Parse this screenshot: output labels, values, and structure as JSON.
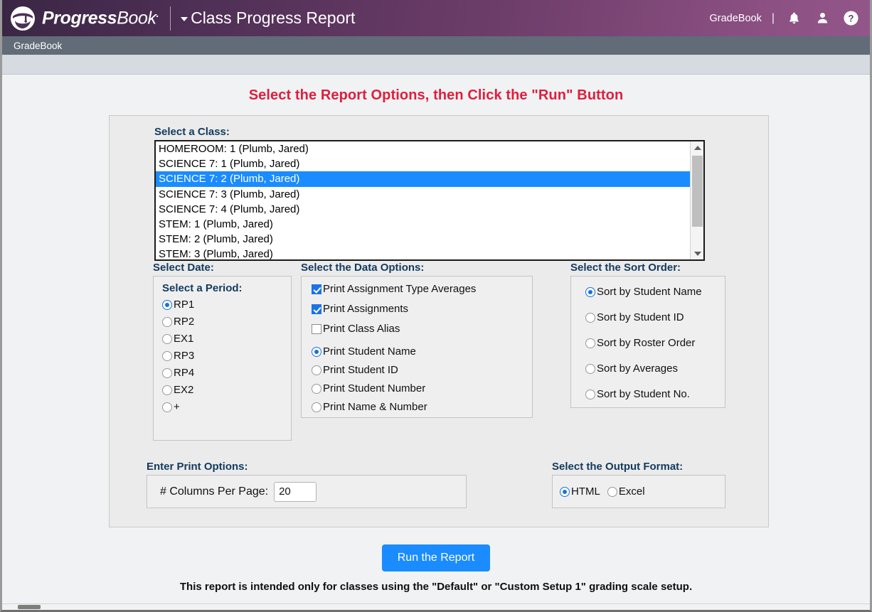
{
  "header": {
    "brand_primary": "Progress",
    "brand_secondary": "Book",
    "brand_trademark": ".",
    "page_title": "Class Progress Report",
    "context_label": "GradeBook",
    "separator": "|",
    "icons": [
      "bell-icon",
      "user-icon",
      "help-icon"
    ],
    "gradient_from": "#3a2644",
    "gradient_to": "#93568a"
  },
  "nav": {
    "items": [
      {
        "label": "GradeBook"
      }
    ],
    "background": "#616c78"
  },
  "main": {
    "headline": "Select the Report Options, then Click the \"Run\" Button",
    "headline_color": "#e01e3c"
  },
  "class_select": {
    "label": "Select a Class:",
    "options": [
      {
        "label": "HOMEROOM: 1 (Plumb, Jared)",
        "selected": false
      },
      {
        "label": "SCIENCE 7: 1 (Plumb, Jared)",
        "selected": false
      },
      {
        "label": "SCIENCE 7: 2 (Plumb, Jared)",
        "selected": true
      },
      {
        "label": "SCIENCE 7: 3 (Plumb, Jared)",
        "selected": false
      },
      {
        "label": "SCIENCE 7: 4 (Plumb, Jared)",
        "selected": false
      },
      {
        "label": "STEM: 1 (Plumb, Jared)",
        "selected": false
      },
      {
        "label": "STEM: 2 (Plumb, Jared)",
        "selected": false
      },
      {
        "label": "STEM: 3 (Plumb, Jared)",
        "selected": false
      }
    ],
    "selected_value": "SCIENCE 7: 2 (Plumb, Jared)",
    "selection_color": "#1a8cff"
  },
  "date_group": {
    "label": "Select Date:",
    "period_label": "Select a Period:",
    "periods": [
      {
        "label": "RP1",
        "selected": true
      },
      {
        "label": "RP2",
        "selected": false
      },
      {
        "label": "EX1",
        "selected": false
      },
      {
        "label": "RP3",
        "selected": false
      },
      {
        "label": "RP4",
        "selected": false
      },
      {
        "label": "EX2",
        "selected": false
      },
      {
        "label": "+",
        "selected": false
      }
    ]
  },
  "data_options": {
    "label": "Select the Data Options:",
    "checkboxes": [
      {
        "label": "Print Assignment Type Averages",
        "checked": true
      },
      {
        "label": "Print Assignments",
        "checked": true
      },
      {
        "label": "Print Class Alias",
        "checked": false
      }
    ],
    "radios": [
      {
        "label": "Print Student Name",
        "selected": true
      },
      {
        "label": "Print Student ID",
        "selected": false
      },
      {
        "label": "Print Student Number",
        "selected": false
      },
      {
        "label": "Print Name & Number",
        "selected": false
      }
    ]
  },
  "sort_order": {
    "label": "Select the Sort Order:",
    "options": [
      {
        "label": "Sort by Student Name",
        "selected": true
      },
      {
        "label": "Sort by Student ID",
        "selected": false
      },
      {
        "label": "Sort by Roster Order",
        "selected": false
      },
      {
        "label": "Sort by Averages",
        "selected": false
      },
      {
        "label": "Sort by Student No.",
        "selected": false
      }
    ]
  },
  "print_options": {
    "label": "Enter Print Options:",
    "columns_label": "# Columns Per Page:",
    "columns_value": "20"
  },
  "output_format": {
    "label": "Select the Output Format:",
    "options": [
      {
        "label": "HTML",
        "selected": true
      },
      {
        "label": "Excel",
        "selected": false
      }
    ]
  },
  "actions": {
    "run_label": "Run the Report",
    "run_color": "#1a8cff",
    "footnote": "This report is intended only for classes using the \"Default\" or \"Custom Setup 1\" grading scale setup."
  }
}
